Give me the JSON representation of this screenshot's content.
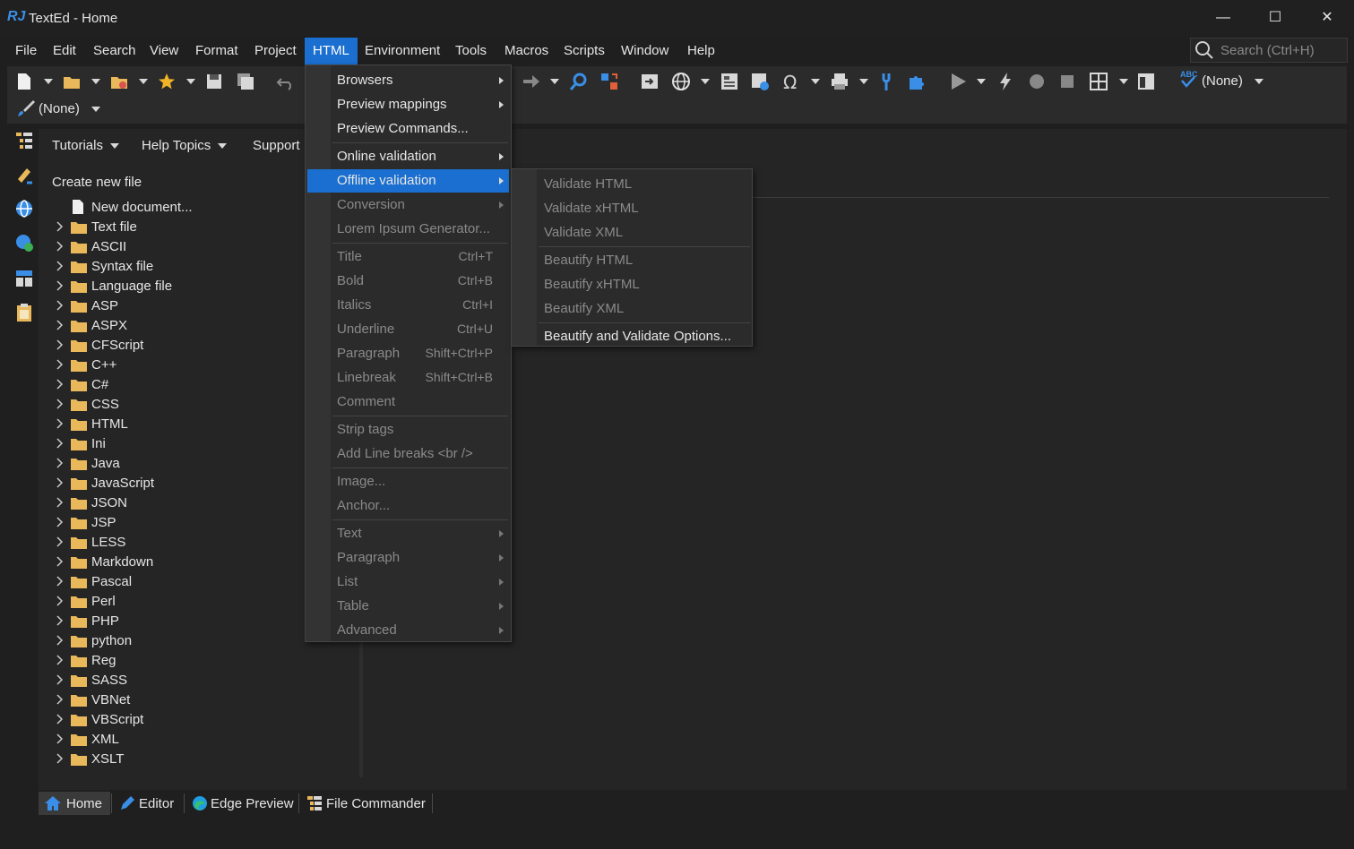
{
  "window": {
    "logo": "RJ",
    "title": "TextEd - Home",
    "minimize": "—",
    "maximize": "☐",
    "close": "✕"
  },
  "menubar": [
    "File",
    "Edit",
    "Search",
    "View",
    "Format",
    "Project",
    "HTML",
    "Environment",
    "Tools",
    "Macros",
    "Scripts",
    "Window",
    "Help"
  ],
  "search": {
    "placeholder": "Search (Ctrl+H)"
  },
  "toolbar": {
    "spellcheck_label": "ABC",
    "spellcheck_value": "(None)",
    "brush_value": "(None)"
  },
  "home": {
    "nav": [
      "Tutorials",
      "Help Topics",
      "Support"
    ],
    "section_title": "Create new file",
    "new_document": "New document...",
    "file_types": [
      "Text file",
      "ASCII",
      "Syntax file",
      "Language file",
      "ASP",
      "ASPX",
      "CFScript",
      "C++",
      "C#",
      "CSS",
      "HTML",
      "Ini",
      "Java",
      "JavaScript",
      "JSON",
      "JSP",
      "LESS",
      "Markdown",
      "Pascal",
      "Perl",
      "PHP",
      "python",
      "Reg",
      "SASS",
      "VBNet",
      "VBScript",
      "XML",
      "XSLT"
    ]
  },
  "html_menu": {
    "items": [
      {
        "label": "Browsers",
        "submenu": true,
        "enabled": true
      },
      {
        "label": "Preview mappings",
        "submenu": true,
        "enabled": true
      },
      {
        "label": "Preview Commands...",
        "enabled": true
      },
      {
        "label": "Online validation",
        "submenu": true,
        "enabled": true
      },
      {
        "label": "Offline validation",
        "submenu": true,
        "enabled": true,
        "highlighted": true
      },
      {
        "label": "Conversion",
        "submenu": true,
        "enabled": false
      },
      {
        "label": "Lorem Ipsum Generator...",
        "enabled": false
      },
      {
        "label": "Title",
        "shortcut": "Ctrl+T",
        "enabled": false
      },
      {
        "label": "Bold",
        "shortcut": "Ctrl+B",
        "enabled": false
      },
      {
        "label": "Italics",
        "shortcut": "Ctrl+I",
        "enabled": false
      },
      {
        "label": "Underline",
        "shortcut": "Ctrl+U",
        "enabled": false
      },
      {
        "label": "Paragraph",
        "shortcut": "Shift+Ctrl+P",
        "enabled": false
      },
      {
        "label": "Linebreak",
        "shortcut": "Shift+Ctrl+B",
        "enabled": false
      },
      {
        "label": "Comment",
        "enabled": false
      },
      {
        "label": "Strip tags",
        "enabled": false
      },
      {
        "label": "Add Line breaks <br />",
        "enabled": false
      },
      {
        "label": "Image...",
        "enabled": false
      },
      {
        "label": "Anchor...",
        "enabled": false
      },
      {
        "label": "Text",
        "submenu": true,
        "enabled": false
      },
      {
        "label": "Paragraph",
        "submenu": true,
        "enabled": false
      },
      {
        "label": "List",
        "submenu": true,
        "enabled": false
      },
      {
        "label": "Table",
        "submenu": true,
        "enabled": false
      },
      {
        "label": "Advanced",
        "submenu": true,
        "enabled": false
      }
    ]
  },
  "offline_validation_menu": {
    "items": [
      {
        "label": "Validate HTML",
        "enabled": false
      },
      {
        "label": "Validate xHTML",
        "enabled": false
      },
      {
        "label": "Validate XML",
        "enabled": false
      },
      {
        "label": "Beautify HTML",
        "enabled": false
      },
      {
        "label": "Beautify xHTML",
        "enabled": false
      },
      {
        "label": "Beautify XML",
        "enabled": false
      },
      {
        "label": "Beautify and Validate Options...",
        "enabled": true
      }
    ]
  },
  "tabs": [
    {
      "label": "Home",
      "icon": "home-icon",
      "active": true
    },
    {
      "label": "Editor",
      "icon": "pencil-icon",
      "active": false
    },
    {
      "label": "Edge Preview",
      "icon": "edge-icon",
      "active": false
    },
    {
      "label": "File Commander",
      "icon": "file-commander-icon",
      "active": false
    }
  ],
  "colors": {
    "accent": "#1a6fd0",
    "folder": "#e8b85a",
    "background": "#1f1f1f"
  }
}
